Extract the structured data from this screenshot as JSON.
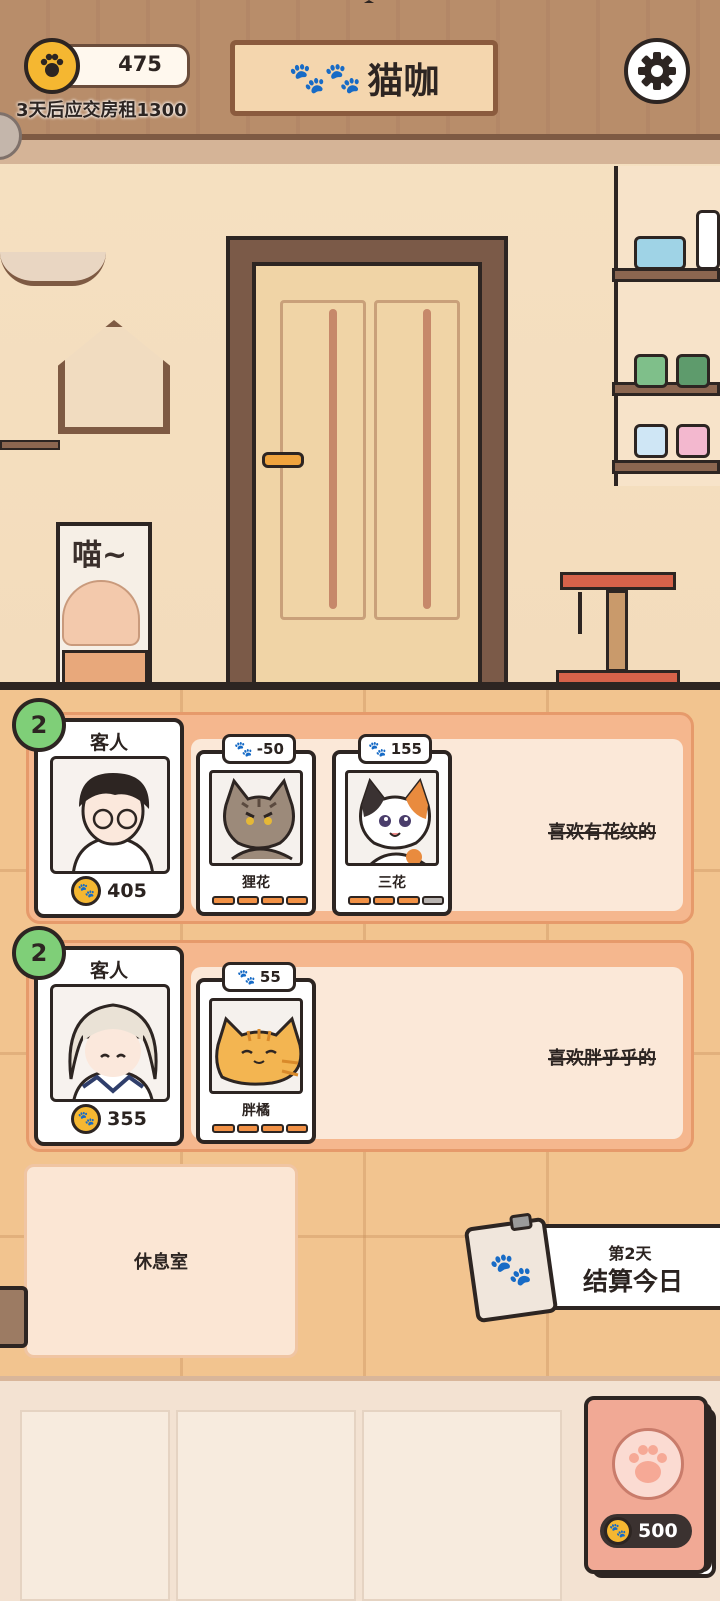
{
  "hud": {
    "coins": "475",
    "rent_notice": "3天后应交房租1300",
    "title": "猫咖",
    "title_paws": "🐾🐾"
  },
  "room": {
    "sign_text": "喵~"
  },
  "customers": [
    {
      "label": "客人",
      "refresh_badge": "2",
      "pay": "405",
      "preference": "喜欢有花纹的",
      "cats": [
        {
          "name": "狸花",
          "score": "-50",
          "bar_filled": 4,
          "bar_total": 4
        },
        {
          "name": "三花",
          "score": "155",
          "bar_filled": 3,
          "bar_total": 4
        }
      ]
    },
    {
      "label": "客人",
      "refresh_badge": "2",
      "pay": "355",
      "preference": "喜欢胖乎乎的",
      "cats": [
        {
          "name": "胖橘",
          "score": "55",
          "bar_filled": 4,
          "bar_total": 4
        }
      ]
    }
  ],
  "rest_room": {
    "label": "休息室"
  },
  "end_day": {
    "day": "第2天",
    "label": "结算今日"
  },
  "deck": {
    "price": "500"
  },
  "colors": {
    "coin": "#f5b731",
    "refresh": "#7fcf78",
    "bar_fill": "#f29145",
    "row_bg": "#f5b78e"
  }
}
